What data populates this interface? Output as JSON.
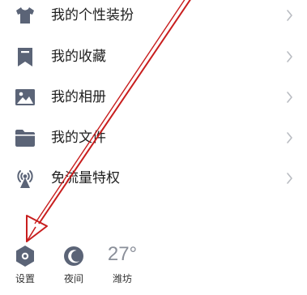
{
  "menu": {
    "items": [
      {
        "label": "我的个性装扮",
        "icon": "tshirt-icon"
      },
      {
        "label": "我的收藏",
        "icon": "bookmark-icon"
      },
      {
        "label": "我的相册",
        "icon": "image-icon"
      },
      {
        "label": "我的文件",
        "icon": "folder-icon"
      },
      {
        "label": "免流量特权",
        "icon": "broadcast-tower-icon"
      }
    ]
  },
  "bottom_bar": {
    "settings_label": "设置",
    "night_label": "夜间",
    "weather_temp": "27°",
    "weather_city": "潍坊"
  },
  "colors": {
    "icon": "#5b6477",
    "text": "#1e1e1e",
    "chevron": "#b9bcc2",
    "annotation_arrow": "#c81e1e",
    "weather_text": "#8a8f99"
  }
}
